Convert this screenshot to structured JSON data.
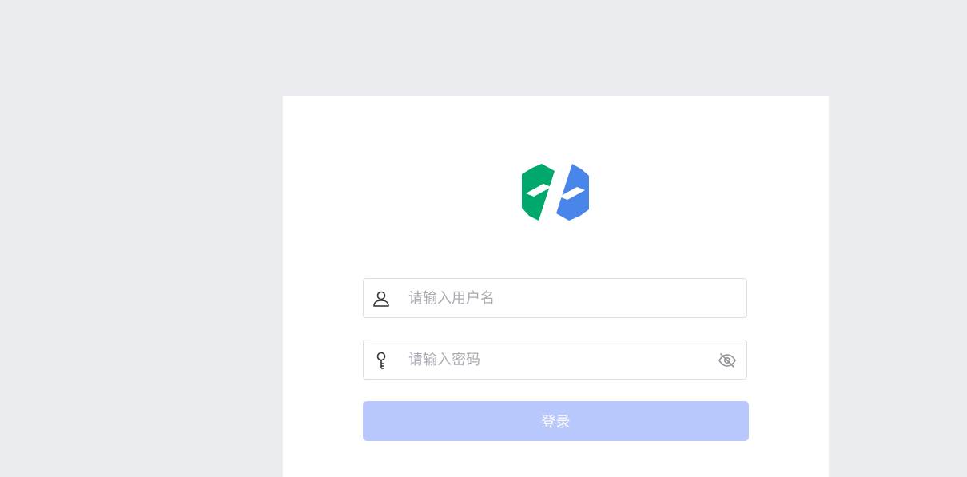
{
  "logo": {
    "icon": "brand-logo-icon",
    "colors": {
      "left": "#00a86b",
      "right": "#4a86ea"
    }
  },
  "form": {
    "username": {
      "placeholder": "请输入用户名",
      "value": "",
      "icon": "user-icon"
    },
    "password": {
      "placeholder": "请输入密码",
      "value": "",
      "icon": "key-icon",
      "toggle_icon": "eye-off-icon"
    },
    "login_label": "登录"
  },
  "colors": {
    "background": "#ebecf0",
    "card": "#ffffff",
    "button": "#b8c8fc",
    "border": "#dcdfe6",
    "placeholder": "#a8abb2"
  }
}
